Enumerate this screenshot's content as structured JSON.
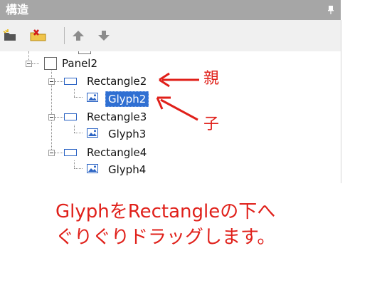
{
  "panel": {
    "title": "構造"
  },
  "toolbar": {
    "buttons": [
      {
        "name": "new-item",
        "icon": "new-item-icon"
      },
      {
        "name": "delete-item",
        "icon": "delete-item-icon"
      },
      {
        "name": "move-up",
        "icon": "arrow-up-icon"
      },
      {
        "name": "move-down",
        "icon": "arrow-down-icon"
      }
    ]
  },
  "tree": {
    "nodes": [
      {
        "label": "Panel2",
        "type": "panel",
        "expanded": true
      },
      {
        "label": "Rectangle2",
        "type": "rectangle",
        "expanded": true
      },
      {
        "label": "Glyph2",
        "type": "glyph",
        "selected": true
      },
      {
        "label": "Rectangle3",
        "type": "rectangle",
        "expanded": true
      },
      {
        "label": "Glyph3",
        "type": "glyph"
      },
      {
        "label": "Rectangle4",
        "type": "rectangle",
        "expanded": true
      },
      {
        "label": "Glyph4",
        "type": "glyph"
      }
    ]
  },
  "annotations": {
    "parent_label": "親",
    "child_label": "子",
    "note_line1": "GlyphをRectangleの下へ",
    "note_line2": "ぐりぐりドラッグします。",
    "color": "#e0201a"
  },
  "colors": {
    "titlebar": "#a6a6a6",
    "selection": "#2f6fd2"
  }
}
